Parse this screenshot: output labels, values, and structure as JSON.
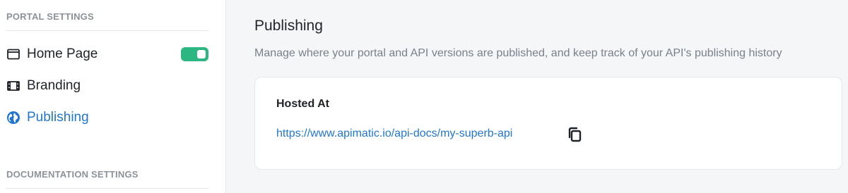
{
  "sidebar": {
    "portal_heading": "PORTAL SETTINGS",
    "documentation_heading": "DOCUMENTATION SETTINGS",
    "items": [
      {
        "label": "Home Page",
        "icon": "browser-window-icon",
        "toggle": true
      },
      {
        "label": "Branding",
        "icon": "film-icon"
      },
      {
        "label": "Publishing",
        "icon": "globe-icon",
        "active": true
      }
    ]
  },
  "main": {
    "title": "Publishing",
    "description": "Manage where your portal and API versions are published, and keep track of your API's publishing history",
    "card": {
      "label": "Hosted At",
      "url": "https://www.apimatic.io/api-docs/my-superb-api",
      "copy_icon": "copy-icon"
    }
  },
  "colors": {
    "accent": "#2176d2",
    "toggle_on": "#2bb682"
  }
}
